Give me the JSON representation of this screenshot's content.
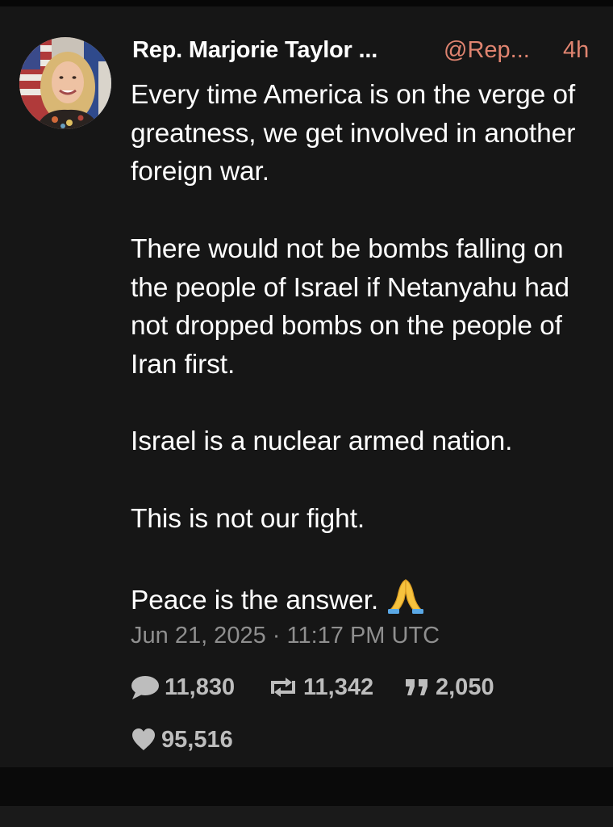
{
  "tweet": {
    "display_name": "Rep. Marjorie Taylor ...",
    "handle": "@Rep...",
    "time_ago": "4h",
    "paragraphs": [
      "Every time America is on the verge of greatness, we get involved in another foreign war.",
      "There would not be bombs falling on the people of Israel if Netanyahu had not dropped bombs on the people of Iran first.",
      "Israel is a nuclear armed nation.",
      "This is not our fight.",
      "Peace is the answer."
    ],
    "emoji": "folded-hands",
    "timestamp": "Jun 21, 2025 · 11:17 PM UTC",
    "stats": {
      "replies": "11,830",
      "retweets": "11,342",
      "quotes": "2,050",
      "likes": "95,516"
    }
  },
  "icons": {
    "avatar": "profile-photo",
    "replies": "speech-bubble-icon",
    "retweets": "retweet-icon",
    "quotes": "quote-icon",
    "likes": "heart-icon"
  },
  "colors": {
    "background": "#161616",
    "text": "#ffffff",
    "accent": "#e08470",
    "muted": "#8f8f8f",
    "stat": "#bdbdbd"
  }
}
